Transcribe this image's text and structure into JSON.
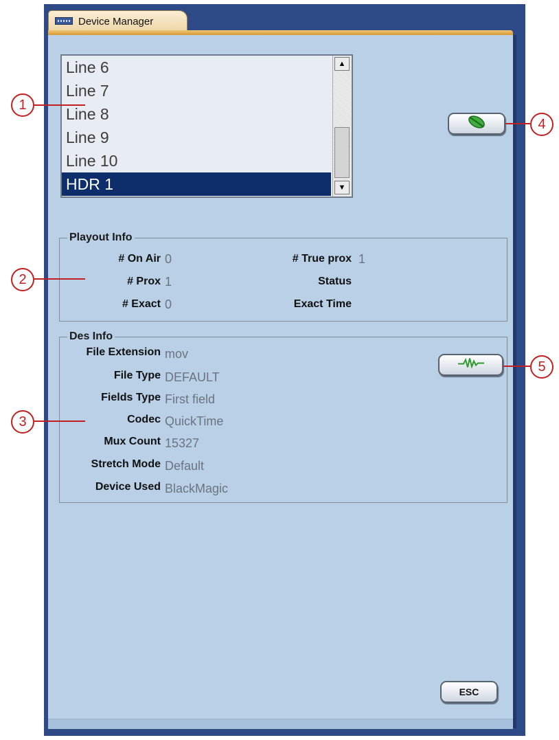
{
  "window": {
    "tab_title": "Device Manager"
  },
  "line_list": {
    "items": [
      "Line 6",
      "Line 7",
      "Line 8",
      "Line 9",
      "Line 10",
      "HDR 1"
    ],
    "selected": "HDR 1"
  },
  "playout_info": {
    "title": "Playout Info",
    "on_air_label": "# On Air",
    "on_air_value": "0",
    "prox_label": "# Prox",
    "prox_value": "1",
    "exact_label": "# Exact",
    "exact_value": "0",
    "true_prox_label": "# True prox",
    "true_prox_value": "1",
    "status_label": "Status",
    "status_value": "",
    "exact_time_label": "Exact Time",
    "exact_time_value": ""
  },
  "des_info": {
    "title": "Des Info",
    "rows": [
      {
        "label": "File Extension",
        "value": "mov"
      },
      {
        "label": "File Type",
        "value": "DEFAULT"
      },
      {
        "label": "Fields Type",
        "value": "First field"
      },
      {
        "label": "Codec",
        "value": "QuickTime"
      },
      {
        "label": "Mux Count",
        "value": "15327"
      },
      {
        "label": "Stretch Mode",
        "value": "Default"
      },
      {
        "label": "Device Used",
        "value": "BlackMagic"
      }
    ]
  },
  "buttons": {
    "esc_label": "ESC",
    "leaf_icon": "leaf-icon",
    "wave_icon": "waveform-icon"
  },
  "callouts": [
    "1",
    "2",
    "3",
    "4",
    "5"
  ],
  "colors": {
    "panel": "#b9d0e6",
    "frame": "#2e4a86",
    "selection": "#0d2d6b",
    "tab": "#efd7a8",
    "callout": "#c22020",
    "icon_green": "#2f9a2f"
  }
}
